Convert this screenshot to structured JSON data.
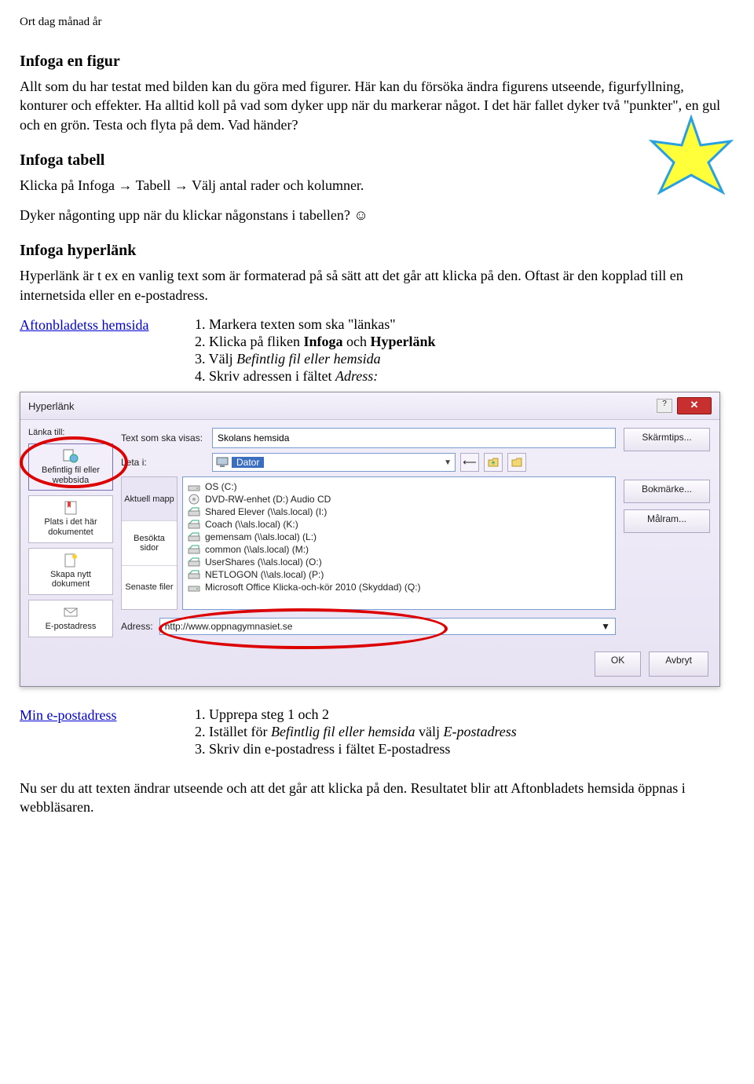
{
  "header_line": "Ort dag månad år",
  "section1": {
    "title": "Infoga en figur",
    "p": "Allt som du har testat med bilden kan du göra med figurer. Här kan du försöka ändra figurens utseende, figurfyllning, konturer och effekter. Ha alltid koll på vad som dyker upp när du markerar något. I det här fallet dyker två \"punkter\", en gul och en grön. Testa och flyta på dem. Vad händer?"
  },
  "section2": {
    "title": "Infoga tabell",
    "p1": "Klicka på Infoga → Tabell → Välj antal rader och kolumner.",
    "p2": "Dyker någonting upp när du klickar någonstans i tabellen? ☺"
  },
  "section3": {
    "title": "Infoga hyperlänk",
    "p": "Hyperlänk är t ex en vanlig text som är formaterad på så sätt att det går att klicka på den. Oftast är den kopplad till en internetsida eller en e-postadress."
  },
  "instruct1": {
    "link": "Aftonbladetss hemsida",
    "s1": "1. Markera texten som ska \"länkas\"",
    "s2a": "2. Klicka på fliken ",
    "s2b": "Infoga",
    "s2c": " och ",
    "s2d": "Hyperlänk",
    "s3a": "3. Välj ",
    "s3b": "Befintlig fil eller hemsida",
    "s4a": "4. Skriv adressen i fältet ",
    "s4b": "Adress:"
  },
  "dialog": {
    "title": "Hyperlänk",
    "link_to_label": "Länka till:",
    "left": {
      "item1": "Befintlig fil eller webbsida",
      "item2": "Plats i det här dokumentet",
      "item3": "Skapa nytt dokument",
      "item4": "E-postadress"
    },
    "display_label": "Text som ska visas:",
    "display_value": "Skolans hemsida",
    "lookin_label": "Leta i:",
    "lookin_value": "Dator",
    "tabs": {
      "t1": "Aktuell mapp",
      "t2": "Besökta sidor",
      "t3": "Senaste filer"
    },
    "files": [
      "OS (C:)",
      "DVD-RW-enhet (D:) Audio CD",
      "Shared Elever (\\\\als.local) (I:)",
      "Coach (\\\\als.local) (K:)",
      "gemensam (\\\\als.local) (L:)",
      "common (\\\\als.local) (M:)",
      "UserShares (\\\\als.local) (O:)",
      "NETLOGON (\\\\als.local) (P:)",
      "Microsoft Office Klicka-och-kör 2010 (Skyddad) (Q:)"
    ],
    "address_label": "Adress:",
    "address_value": "http://www.oppnagymnasiet.se",
    "btn_skarmtips": "Skärmtips...",
    "btn_bokmarke": "Bokmärke...",
    "btn_malram": "Målram...",
    "btn_ok": "OK",
    "btn_cancel": "Avbryt"
  },
  "instruct2": {
    "link": "Min e-postadress",
    "s1": "1. Upprepa steg 1 och 2",
    "s2a": "2. Istället för ",
    "s2b": "Befintlig fil eller hemsida",
    "s2c": " välj ",
    "s2d": "E-postadress",
    "s3": "3. Skriv din e-postadress i fältet E-postadress"
  },
  "closing": "Nu ser du att texten ändrar utseende och att det går att klicka på den. Resultatet blir att Aftonbladets hemsida öppnas i webbläsaren."
}
